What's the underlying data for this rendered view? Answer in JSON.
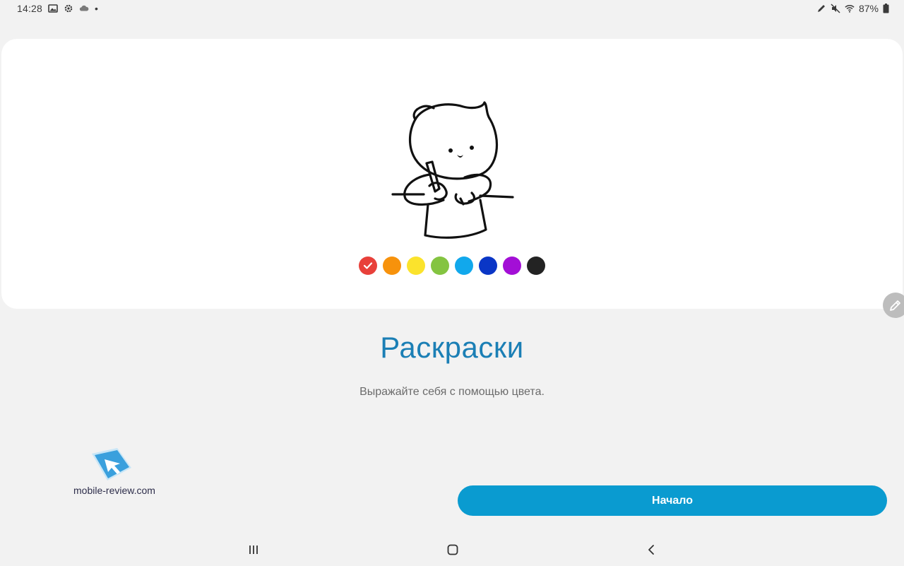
{
  "status_bar": {
    "time": "14:28",
    "left_icons": [
      "gallery-icon",
      "settings-icon",
      "cloud-icon"
    ],
    "dot": "•",
    "right_icons": [
      "pen-icon",
      "mute-icon",
      "wifi-icon"
    ],
    "battery": "87%"
  },
  "card": {
    "swatches": [
      {
        "color": "#e8403a",
        "selected": true
      },
      {
        "color": "#f7920c",
        "selected": false
      },
      {
        "color": "#fbe32c",
        "selected": false
      },
      {
        "color": "#84c441",
        "selected": false
      },
      {
        "color": "#11a8ec",
        "selected": false
      },
      {
        "color": "#0a36c6",
        "selected": false
      },
      {
        "color": "#a30fd6",
        "selected": false
      },
      {
        "color": "#232323",
        "selected": false
      }
    ]
  },
  "title": "Раскраски",
  "subtitle": "Выражайте себя с помощью цвета.",
  "watermark": {
    "text": "mobile-review.com"
  },
  "start_button": {
    "label": "Начало"
  },
  "colors": {
    "accent": "#0a9bd0",
    "title": "#1b7fb5",
    "background": "#f2f2f2"
  }
}
